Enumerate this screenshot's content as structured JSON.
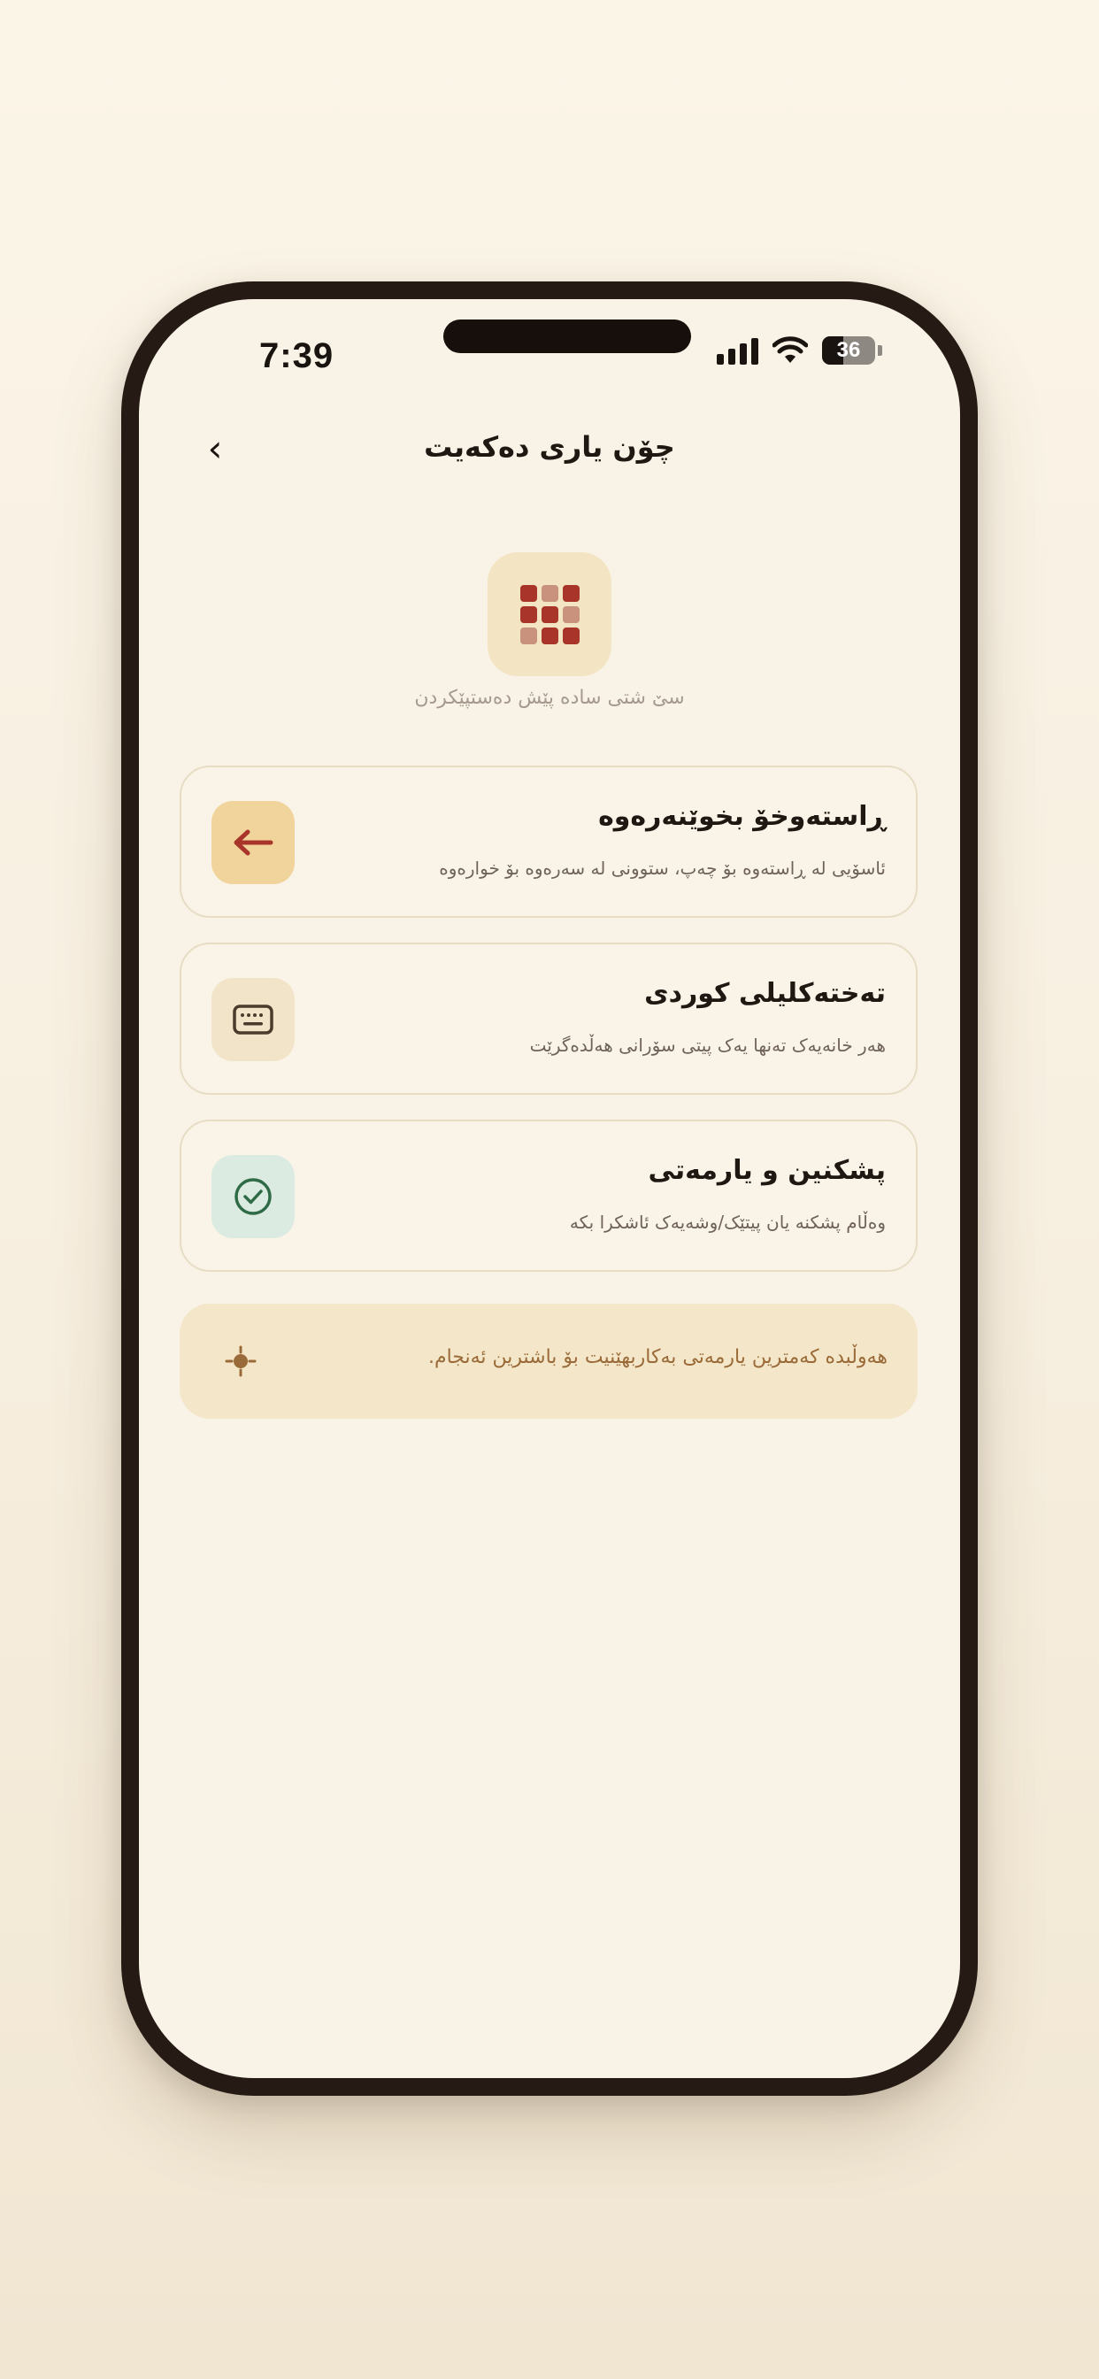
{
  "status_bar": {
    "time": "7:39",
    "battery": "36"
  },
  "nav": {
    "back_label": "‹",
    "title": "چۆن یاری دەکەیت"
  },
  "hero": {
    "subtitle": "سێ شتی سادە پێش دەستپێکردن"
  },
  "cards": [
    {
      "title": "ڕاستەوخۆ بخوێنەرەوە",
      "description": "ئاسۆیی لە ڕاستەوە بۆ چەپ، ستوونی لە سەرەوە بۆ خوارەوە",
      "icon": "arrow-left-icon",
      "icon_bg": "#f1d49c",
      "icon_color": "#a8342a"
    },
    {
      "title": "تەختەکلیلی کوردی",
      "description": "هەر خانەیەک تەنها یەک پیتی سۆرانی هەڵدەگرێت",
      "icon": "keyboard-icon",
      "icon_bg": "#f1e4c8",
      "icon_color": "#4a3b2c"
    },
    {
      "title": "پشکنین و یارمەتی",
      "description": "وەڵام پشکنە یان پیتێک/وشەیەک ئاشکرا بکە",
      "icon": "check-circle-icon",
      "icon_bg": "#dcebe1",
      "icon_color": "#2f6b46"
    }
  ],
  "tip": {
    "text": "هەوڵبدە کەمترین یارمەتی بەکاربهێنیت بۆ باشترین ئەنجام.",
    "icon": "sun-icon"
  },
  "colors": {
    "accent_red": "#a8342a",
    "tile_light": "#c9927c",
    "background": "#f9f3e7"
  }
}
